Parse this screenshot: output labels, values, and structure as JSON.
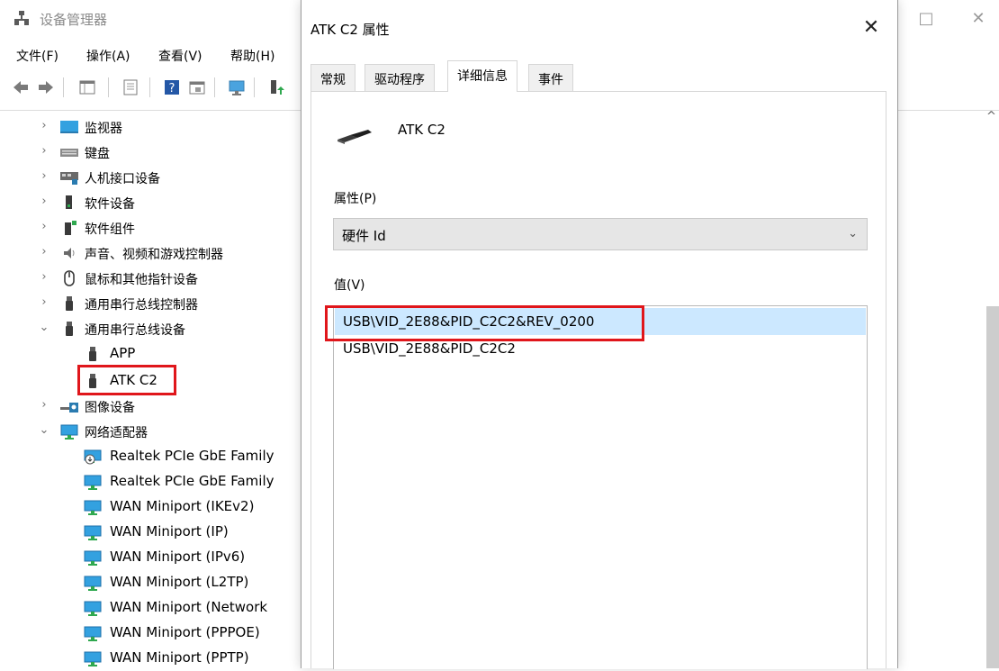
{
  "device_manager": {
    "title": "设备管理器",
    "menu": [
      "文件(F)",
      "操作(A)",
      "查看(V)",
      "帮助(H)"
    ],
    "window_buttons": {
      "minimize": "—",
      "maximize": "□",
      "close": "✕"
    },
    "tree": [
      {
        "label": "监视器",
        "expander": "›",
        "icon": "monitor-icon"
      },
      {
        "label": "键盘",
        "expander": "›",
        "icon": "keyboard-icon"
      },
      {
        "label": "人机接口设备",
        "expander": "›",
        "icon": "hid-icon"
      },
      {
        "label": "软件设备",
        "expander": "›",
        "icon": "software-device-icon"
      },
      {
        "label": "软件组件",
        "expander": "›",
        "icon": "software-component-icon"
      },
      {
        "label": "声音、视频和游戏控制器",
        "expander": "›",
        "icon": "speaker-icon"
      },
      {
        "label": "鼠标和其他指针设备",
        "expander": "›",
        "icon": "mouse-icon"
      },
      {
        "label": "通用串行总线控制器",
        "expander": "›",
        "icon": "usb-icon"
      },
      {
        "label": "通用串行总线设备",
        "expander": "⌄",
        "icon": "usb-icon"
      },
      {
        "label": "APP",
        "icon": "usb-icon"
      },
      {
        "label": "ATK C2",
        "icon": "usb-icon"
      },
      {
        "label": "图像设备",
        "expander": "›",
        "icon": "camera-icon"
      },
      {
        "label": "网络适配器",
        "expander": "⌄",
        "icon": "network-adapter-icon"
      },
      {
        "label": "Realtek PCIe GbE Family",
        "icon": "network-disabled-icon"
      },
      {
        "label": "Realtek PCIe GbE Family",
        "icon": "network-adapter-icon"
      },
      {
        "label": "WAN Miniport (IKEv2)",
        "icon": "network-adapter-icon"
      },
      {
        "label": "WAN Miniport (IP)",
        "icon": "network-adapter-icon"
      },
      {
        "label": "WAN Miniport (IPv6)",
        "icon": "network-adapter-icon"
      },
      {
        "label": "WAN Miniport (L2TP)",
        "icon": "network-adapter-icon"
      },
      {
        "label": "WAN Miniport (Network",
        "icon": "network-adapter-icon"
      },
      {
        "label": "WAN Miniport (PPPOE)",
        "icon": "network-adapter-icon"
      },
      {
        "label": "WAN Miniport (PPTP)",
        "icon": "network-adapter-icon"
      }
    ]
  },
  "dialog": {
    "title": "ATK C2 属性",
    "close": "✕",
    "tabs": [
      "常规",
      "驱动程序",
      "详细信息",
      "事件"
    ],
    "active_tab": "详细信息",
    "device_name": "ATK C2",
    "property_label": "属性(P)",
    "property_value": "硬件 Id",
    "value_label": "值(V)",
    "values": [
      "USB\\VID_2E88&PID_C2C2&REV_0200",
      "USB\\VID_2E88&PID_C2C2"
    ]
  },
  "colors": {
    "highlight": "#e0161b",
    "selection": "#cce8ff",
    "accent": "#1a7fd6"
  }
}
